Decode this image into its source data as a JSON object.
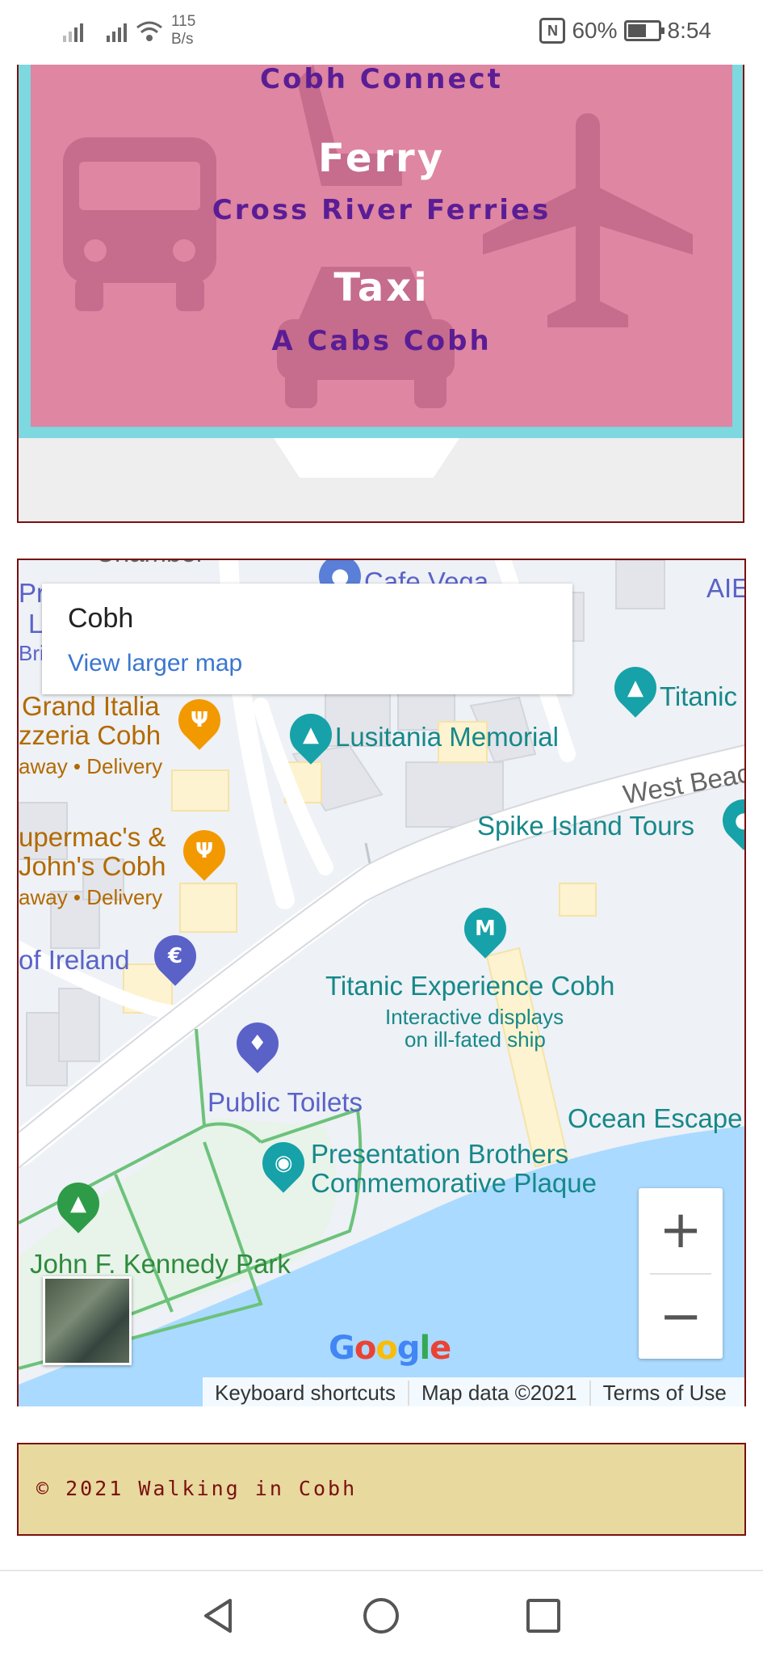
{
  "status_bar": {
    "speed_value": "115",
    "speed_unit": "B/s",
    "nfc_label": "N",
    "battery": "60%",
    "time": "8:54"
  },
  "transport": {
    "top_sub": "Cobh Connect",
    "ferry_heading": "Ferry",
    "ferry_sub": "Cross River Ferries",
    "taxi_heading": "Taxi",
    "taxi_sub": "A Cabs Cobh"
  },
  "map": {
    "infobox": {
      "title": "Cobh",
      "link": "View larger map"
    },
    "labels": {
      "top_cut": "Cafe Vega",
      "titanic_right": "Titanic",
      "grand_italia_1": "Grand Italia",
      "grand_italia_2": "zzeria Cobh",
      "grand_italia_3": "away • Delivery",
      "lusitania": "Lusitania Memorial",
      "west_beach": "West Beac",
      "spike": "Spike Island Tours",
      "supermacs_1": "upermac's &",
      "supermacs_2": "John's Cobh",
      "supermacs_3": "away • Delivery",
      "bank_ireland": "of Ireland",
      "titanic_exp": "Titanic Experience Cobh",
      "titanic_exp_d1": "Interactive displays",
      "titanic_exp_d2": "on ill-fated ship",
      "public_toilets": "Public Toilets",
      "ocean_escape": "Ocean Escape",
      "presentation_1": "Presentation Brothers",
      "presentation_2": "Commemorative Plaque",
      "jfk_park": "John F. Kennedy Park",
      "aib": "AIE",
      "left_p": "Pr",
      "left_l": "L",
      "left_bri": "Bri"
    },
    "zoom_in": "+",
    "zoom_out": "−",
    "google": "Google",
    "attribution": {
      "shortcuts": "Keyboard shortcuts",
      "data": "Map data ©2021",
      "terms": "Terms of Use"
    }
  },
  "footer": {
    "copyright": "© 2021 Walking in Cobh"
  },
  "colors": {
    "pink": "#de86a2",
    "teal": "#7dd8e0",
    "purple": "#5b1d95",
    "maroon": "#7a1010",
    "footer_bg": "#e8d99e",
    "water": "#aadaff"
  }
}
